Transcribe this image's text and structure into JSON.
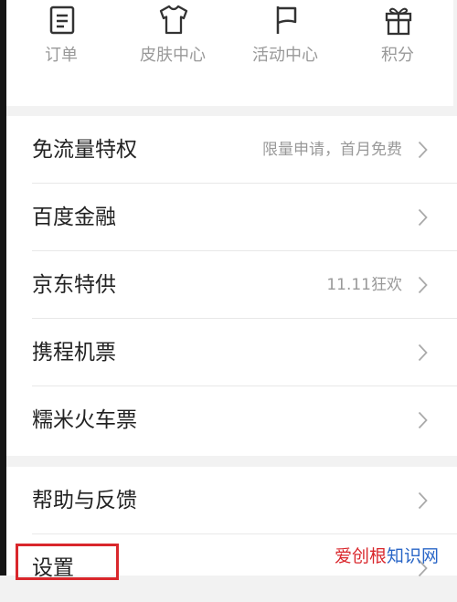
{
  "quick_actions": [
    {
      "label": "订单",
      "icon": "order-icon"
    },
    {
      "label": "皮肤中心",
      "icon": "tshirt-icon"
    },
    {
      "label": "活动中心",
      "icon": "flag-icon"
    },
    {
      "label": "积分",
      "icon": "gift-icon"
    }
  ],
  "menu_group_1": [
    {
      "title": "免流量特权",
      "subtitle": "限量申请，首月免费"
    },
    {
      "title": "百度金融",
      "subtitle": ""
    },
    {
      "title": "京东特供",
      "subtitle": "11.11狂欢"
    },
    {
      "title": "携程机票",
      "subtitle": ""
    },
    {
      "title": "糯米火车票",
      "subtitle": ""
    }
  ],
  "menu_group_2": [
    {
      "title": "帮助与反馈"
    },
    {
      "title": "设置"
    }
  ],
  "watermark": {
    "part1": "爱创根",
    "part2": "知识网"
  },
  "colors": {
    "highlight": "#d9272c",
    "watermark_red": "#d9272c",
    "watermark_blue": "#2a66c7"
  }
}
